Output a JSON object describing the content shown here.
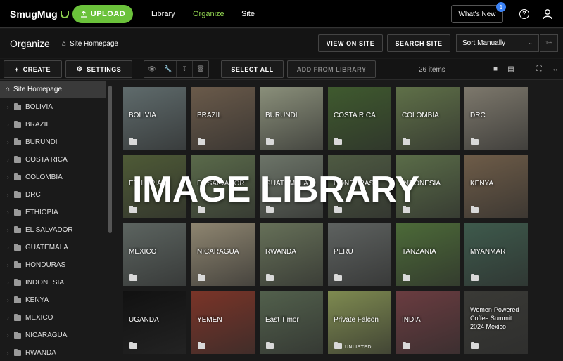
{
  "app": {
    "logo_text": "SmugMug",
    "upload_label": "UPLOAD"
  },
  "nav": {
    "library": "Library",
    "organize": "Organize",
    "site": "Site",
    "whats_new": "What's New",
    "notif_count": "1",
    "help_icon": "help-icon",
    "user_icon": "user-icon"
  },
  "subbar": {
    "title": "Organize",
    "breadcrumb": "Site Homepage",
    "view_on_site": "VIEW ON SITE",
    "search_site": "SEARCH SITE",
    "sort_value": "Sort Manually",
    "page_range": "1-9"
  },
  "toolbar": {
    "create": "CREATE",
    "settings": "SETTINGS",
    "select_all": "SELECT ALL",
    "add_from_library": "ADD FROM LIBRARY",
    "item_count": "26 items"
  },
  "sidebar": {
    "root": "Site Homepage",
    "items": [
      "BOLIVIA",
      "BRAZIL",
      "BURUNDI",
      "COSTA RICA",
      "COLOMBIA",
      "DRC",
      "ETHIOPIA",
      "EL SALVADOR",
      "GUATEMALA",
      "HONDURAS",
      "INDONESIA",
      "KENYA",
      "MEXICO",
      "NICARAGUA",
      "RWANDA"
    ]
  },
  "tiles": [
    {
      "label": "BOLIVIA",
      "color": "#5f6b6c"
    },
    {
      "label": "BRAZIL",
      "color": "#6a5a4a"
    },
    {
      "label": "BURUNDI",
      "color": "#8a8f7a"
    },
    {
      "label": "COSTA RICA",
      "color": "#3f5a2e"
    },
    {
      "label": "COLOMBIA",
      "color": "#5f7048"
    },
    {
      "label": "DRC",
      "color": "#7d786c"
    },
    {
      "label": "ETHIOPIA",
      "color": "#4e5a36"
    },
    {
      "label": "EL SALVADOR",
      "color": "#5a6a4a"
    },
    {
      "label": "GUATEMALA",
      "color": "#6c7468"
    },
    {
      "label": "HONDURAS",
      "color": "#4e5a42"
    },
    {
      "label": "INDONESIA",
      "color": "#5a6c48"
    },
    {
      "label": "KENYA",
      "color": "#6e5c48"
    },
    {
      "label": "MEXICO",
      "color": "#5c6460"
    },
    {
      "label": "NICARAGUA",
      "color": "#8e8570"
    },
    {
      "label": "RWANDA",
      "color": "#667058"
    },
    {
      "label": "PERU",
      "color": "#5e6260"
    },
    {
      "label": "TANZANIA",
      "color": "#4c6a38"
    },
    {
      "label": "MYANMAR",
      "color": "#3e5a4c"
    },
    {
      "label": "UGANDA",
      "color": "#111111"
    },
    {
      "label": "YEMEN",
      "color": "#7a3428"
    },
    {
      "label": "East Timor",
      "color": "#52604c"
    },
    {
      "label": "Private Falcon",
      "color": "#7e8a50",
      "unlisted": "UNLISTED"
    },
    {
      "label": "INDIA",
      "color": "#6a3c40"
    },
    {
      "label": "Women-Powered Coffee Summit 2024 Mexico",
      "color": "#3a3a36"
    }
  ],
  "watermark": "IMAGE LIBRARY"
}
